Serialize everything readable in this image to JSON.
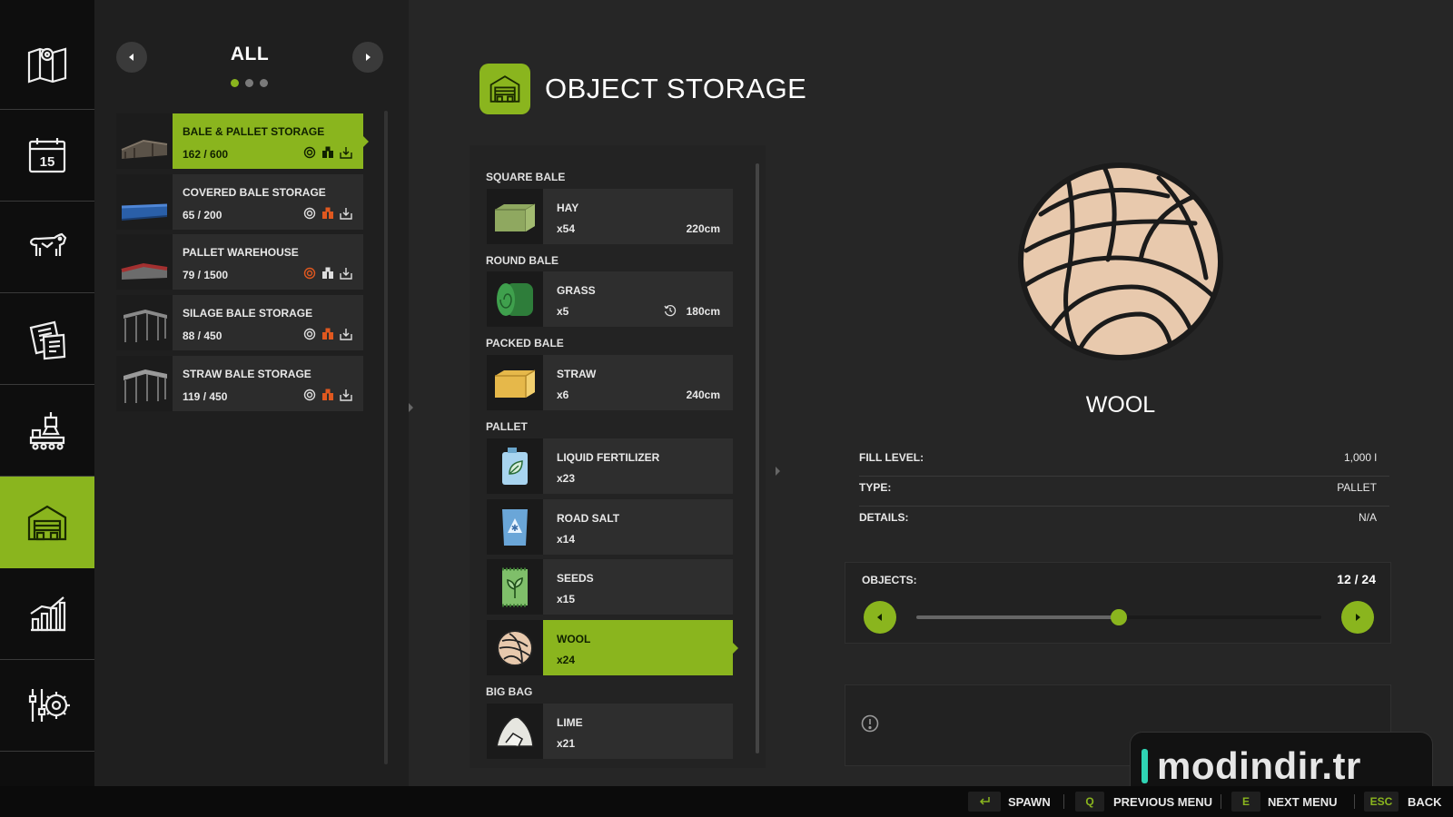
{
  "nav": {
    "items": [
      {
        "icon": "map-icon"
      },
      {
        "icon": "calendar-icon",
        "label": "15"
      },
      {
        "icon": "animals-icon"
      },
      {
        "icon": "contracts-icon"
      },
      {
        "icon": "production-icon"
      },
      {
        "icon": "storage-icon",
        "active": true
      },
      {
        "icon": "statistics-icon"
      },
      {
        "icon": "settings-icon"
      }
    ]
  },
  "list": {
    "filter_title": "ALL",
    "filter_pages": 3,
    "filter_page_index": 0,
    "items": [
      {
        "name": "BALE & PALLET STORAGE",
        "count": "162 / 600",
        "selected": true
      },
      {
        "name": "COVERED BALE STORAGE",
        "count": "65 / 200"
      },
      {
        "name": "PALLET WAREHOUSE",
        "count": "79 / 1500"
      },
      {
        "name": "SILAGE BALE STORAGE",
        "count": "88 / 450"
      },
      {
        "name": "STRAW BALE STORAGE",
        "count": "119 / 450"
      }
    ]
  },
  "main": {
    "title": "OBJECT STORAGE",
    "categories": [
      {
        "label": "SQUARE BALE",
        "items": [
          {
            "name": "HAY",
            "qty": "x54",
            "size": "220cm",
            "icon": "hay-bale-icon"
          }
        ]
      },
      {
        "label": "ROUND BALE",
        "items": [
          {
            "name": "GRASS",
            "qty": "x5",
            "size": "180cm",
            "icon": "round-bale-icon",
            "fermenting": true
          }
        ]
      },
      {
        "label": "PACKED BALE",
        "items": [
          {
            "name": "STRAW",
            "qty": "x6",
            "size": "240cm",
            "icon": "straw-bale-icon"
          }
        ]
      },
      {
        "label": "PALLET",
        "items": [
          {
            "name": "LIQUID FERTILIZER",
            "qty": "x23",
            "icon": "liquid-fertilizer-icon"
          },
          {
            "name": "ROAD SALT",
            "qty": "x14",
            "icon": "road-salt-icon"
          },
          {
            "name": "SEEDS",
            "qty": "x15",
            "icon": "seeds-icon"
          },
          {
            "name": "WOOL",
            "qty": "x24",
            "icon": "wool-icon",
            "selected": true
          }
        ]
      },
      {
        "label": "BIG BAG",
        "items": [
          {
            "name": "LIME",
            "qty": "x21",
            "icon": "lime-icon"
          }
        ]
      }
    ]
  },
  "detail": {
    "name": "WOOL",
    "icon": "wool-icon",
    "props": [
      {
        "label": "FILL LEVEL:",
        "value": "1,000 l"
      },
      {
        "label": "TYPE:",
        "value": "PALLET"
      },
      {
        "label": "DETAILS:",
        "value": "N/A"
      }
    ],
    "objects": {
      "label": "OBJECTS:",
      "count": "12 / 24",
      "value": 12,
      "max": 24
    }
  },
  "footer": {
    "spawn_label": "SPAWN",
    "prev_key": "Q",
    "prev_label": "PREVIOUS MENU",
    "next_key": "E",
    "next_label": "NEXT MENU",
    "back_key": "ESC",
    "back_label": "BACK"
  },
  "watermark": {
    "text": "modindir.tr"
  },
  "colors": {
    "accent": "#8ab51e",
    "background": "#262626",
    "nav_bg": "#0e0e0e"
  }
}
